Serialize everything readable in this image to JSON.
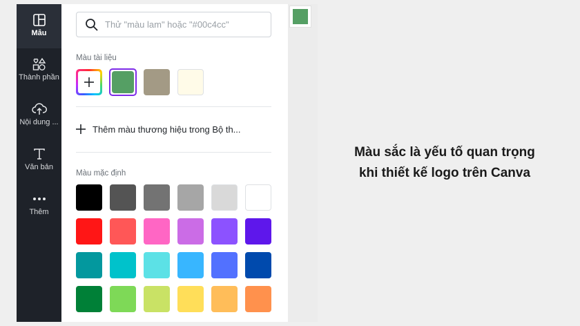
{
  "sidebar": {
    "items": [
      {
        "label": "Mẫu",
        "icon": "layout-icon",
        "active": true
      },
      {
        "label": "Thành phần",
        "icon": "shapes-icon",
        "active": false
      },
      {
        "label": "Nội dung ...",
        "icon": "cloud-upload-icon",
        "active": false
      },
      {
        "label": "Văn bản",
        "icon": "text-icon",
        "active": false
      },
      {
        "label": "Thêm",
        "icon": "more-icon",
        "active": false
      }
    ]
  },
  "panel": {
    "search_placeholder": "Thử \"màu lam\" hoặc \"#00c4cc\"",
    "document_colors_title": "Màu tài liệu",
    "document_colors": [
      "#559f64",
      "#a39a85",
      "#fffbe8"
    ],
    "selected_document_color": "#559f64",
    "add_brand_label": "Thêm màu thương hiệu trong Bộ th...",
    "default_colors_title": "Màu mặc định",
    "default_colors": [
      [
        "#000000",
        "#545454",
        "#737373",
        "#a6a6a6",
        "#d9d9d9",
        "#ffffff"
      ],
      [
        "#ff1616",
        "#ff5757",
        "#ff66c4",
        "#cb6ce6",
        "#8c52ff",
        "#5e17eb"
      ],
      [
        "#03989e",
        "#00c2cb",
        "#5ce1e6",
        "#38b6ff",
        "#5271ff",
        "#004aad"
      ],
      [
        "#008037",
        "#7ed957",
        "#c9e265",
        "#ffde59",
        "#ffbd59",
        "#ff914d"
      ]
    ]
  },
  "canvas": {
    "thumb_color": "#559f64"
  },
  "caption": {
    "line1": "Màu sắc là yếu tố quan trọng",
    "line2": "khi thiết kế logo trên Canva"
  },
  "accent_color": "#7d2ae8"
}
